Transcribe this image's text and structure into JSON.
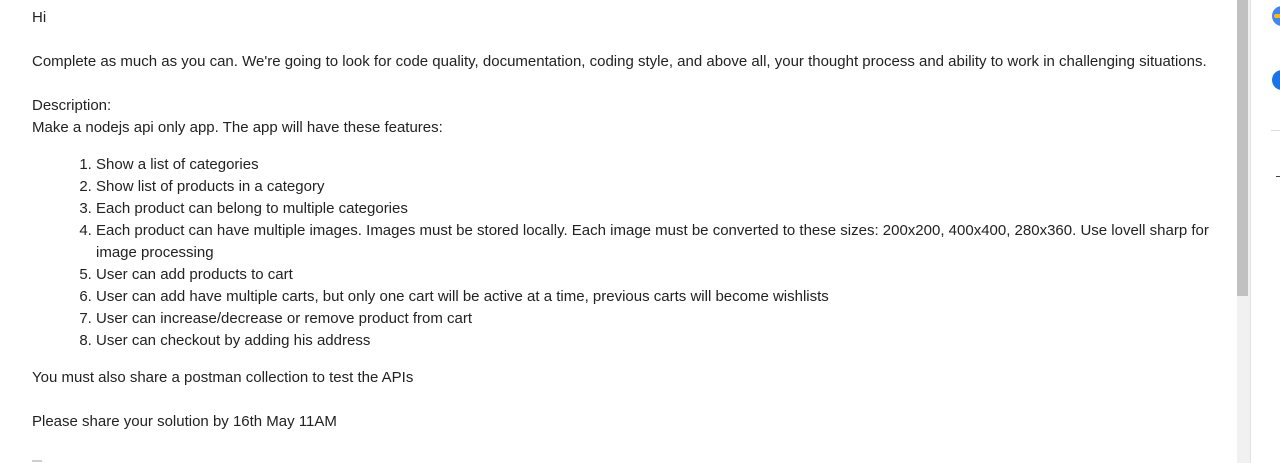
{
  "email": {
    "greeting": "Hi",
    "intro": "Complete as much as you can. We're going to look for code quality, documentation, coding style, and above all, your thought process and ability to work in challenging situations.",
    "description_label": "Description:",
    "description_text": "Make a nodejs api only app. The app will have these features:",
    "features": [
      "Show a list of categories",
      "Show list of products in a category",
      "Each product can belong to multiple categories",
      "Each product can have multiple images. Images must be stored locally. Each image must be converted to these sizes: 200x200, 400x400, 280x360. Use lovell sharp for image processing",
      "User can add products to cart",
      "User can add have multiple carts, but only one cart will be active at a time, previous carts will become wishlists",
      "User can increase/decrease or remove product from cart",
      "User can checkout by adding his address"
    ],
    "postman_note": "You must also share a postman collection to test the APIs",
    "deadline": "Please share your solution by 16th May 11AM"
  },
  "side_panel": {
    "icons": [
      "calendar-icon",
      "tasks-icon"
    ]
  },
  "colors": {
    "text": "#222222",
    "scroll_thumb": "#c1c1c1",
    "accent_blue": "#1a73e8"
  }
}
